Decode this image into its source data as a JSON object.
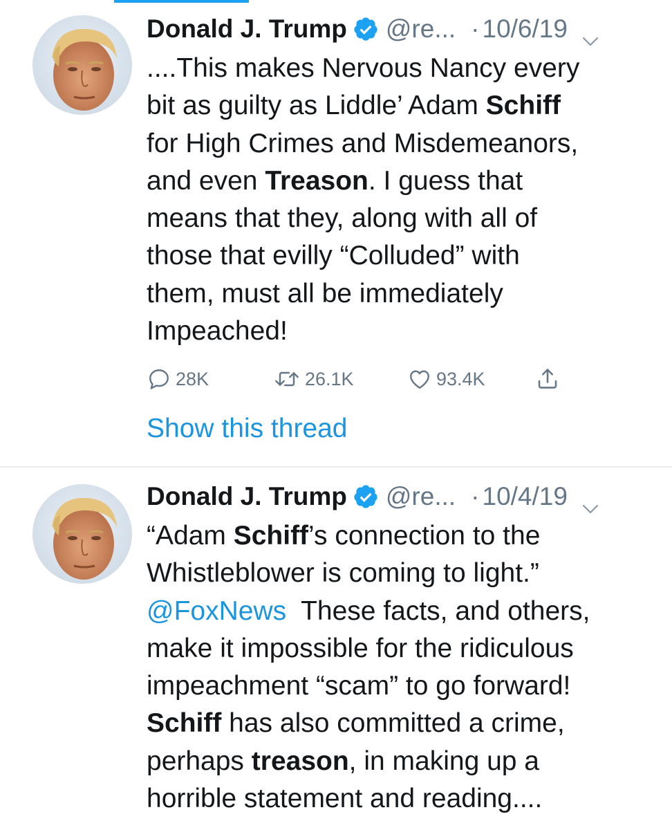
{
  "tweets": [
    {
      "author_name": "Donald J. Trump",
      "handle": "@re...",
      "separator": "·",
      "date": "10/6/19",
      "lines": [
        [
          {
            "t": "....This makes Nervous Nancy every",
            "b": false
          }
        ],
        [
          {
            "t": "bit as guilty as Liddle’ Adam ",
            "b": false
          },
          {
            "t": "Schiff",
            "b": true
          }
        ],
        [
          {
            "t": "for High Crimes and Misdemeanors,",
            "b": false
          }
        ],
        [
          {
            "t": "and even ",
            "b": false
          },
          {
            "t": "Treason",
            "b": true
          },
          {
            "t": ". I guess that",
            "b": false
          }
        ],
        [
          {
            "t": "means that they, along with all of",
            "b": false
          }
        ],
        [
          {
            "t": "those that evilly “Colluded” with",
            "b": false
          }
        ],
        [
          {
            "t": "them, must all be immediately",
            "b": false
          }
        ],
        [
          {
            "t": "Impeached!",
            "b": false
          }
        ]
      ],
      "stats": {
        "replies": "28K",
        "retweets": "26.1K",
        "likes": "93.4K"
      },
      "show_thread_label": "Show this thread"
    },
    {
      "author_name": "Donald J. Trump",
      "handle": "@re...",
      "separator": "·",
      "date": "10/4/19",
      "lines": [
        [
          {
            "t": "“Adam ",
            "b": false
          },
          {
            "t": "Schiff",
            "b": true
          },
          {
            "t": "’s connection to the",
            "b": false
          }
        ],
        [
          {
            "t": "Whistleblower is coming to light.”",
            "b": false
          }
        ],
        [
          {
            "t": "@FoxNews",
            "b": false,
            "link": true
          },
          {
            "t": "  These facts, and others,",
            "b": false
          }
        ],
        [
          {
            "t": "make it impossible for the ridiculous",
            "b": false
          }
        ],
        [
          {
            "t": "impeachment “scam” to go forward!",
            "b": false
          }
        ],
        [
          {
            "t": "Schiff",
            "b": true
          },
          {
            "t": " has also committed a crime,",
            "b": false
          }
        ],
        [
          {
            "t": "perhaps ",
            "b": false
          },
          {
            "t": "treason",
            "b": true
          },
          {
            "t": ", in making up a",
            "b": false
          }
        ],
        [
          {
            "t": "horrible statement and reading....",
            "b": false
          }
        ]
      ]
    }
  ],
  "icons": {
    "verified": "verified-badge-icon",
    "chevron": "chevron-down-icon",
    "reply": "reply-icon",
    "retweet": "retweet-icon",
    "like": "heart-icon",
    "share": "share-icon"
  },
  "colors": {
    "text": "#14171a",
    "secondary": "#657786",
    "link": "#1b95e0",
    "verified": "#1da1f2",
    "divider": "#e6ecf0"
  }
}
